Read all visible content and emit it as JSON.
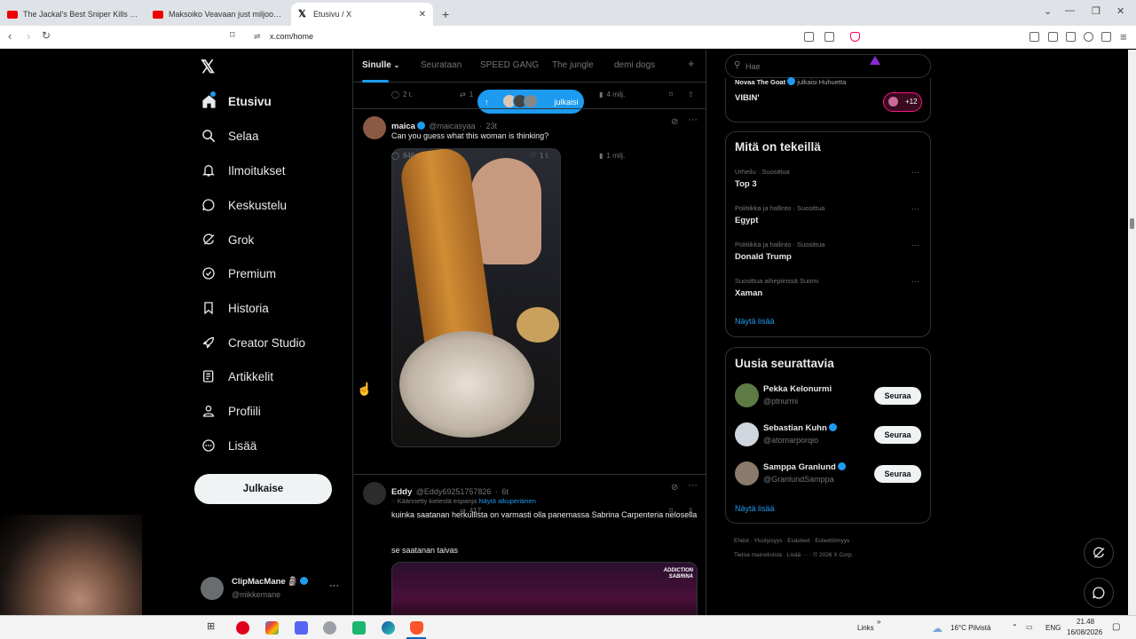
{
  "browser": {
    "tabs": [
      {
        "title": "The Jackal's Best Sniper Kills | The Da",
        "icon": "youtube-icon",
        "active": false
      },
      {
        "title": "Maksoiko Veavaan just miljoonan vil",
        "icon": "youtube-icon",
        "active": false
      },
      {
        "title": "Etusivu / X",
        "icon": "x-icon",
        "active": true
      }
    ],
    "new_tab": "+",
    "url": "x.com/home"
  },
  "sidebar": {
    "logo": "𝕏",
    "items": [
      {
        "label": "Etusivu",
        "icon": "home-icon",
        "active": true
      },
      {
        "label": "Selaa",
        "icon": "search-icon"
      },
      {
        "label": "Ilmoitukset",
        "icon": "bell-icon"
      },
      {
        "label": "Keskustelu",
        "icon": "chat-bubble-icon"
      },
      {
        "label": "Grok",
        "icon": "grok-icon"
      },
      {
        "label": "Premium",
        "icon": "verified-badge-icon"
      },
      {
        "label": "Historia",
        "icon": "bookmark-icon"
      },
      {
        "label": "Creator Studio",
        "icon": "rocket-icon"
      },
      {
        "label": "Artikkelit",
        "icon": "article-icon"
      },
      {
        "label": "Profiili",
        "icon": "person-icon"
      },
      {
        "label": "Lisää",
        "icon": "more-circle-icon"
      }
    ],
    "post_button": "Julkaise",
    "account": {
      "name": "ClipMacMane",
      "emoji": "🗿",
      "handle": "@mikkemane",
      "more": "···"
    }
  },
  "feed": {
    "tabs": [
      "Sinulle",
      "Seurataan",
      "SPEED GANG",
      "The jungle",
      "demi dogs"
    ],
    "active_tab": "Sinulle",
    "add_tab": "+",
    "new_posts_label": "julkaisi",
    "prev_post_stats": {
      "replies": "2 t.",
      "reposts": "1",
      "views": "4 milj."
    },
    "posts": [
      {
        "name": "maica",
        "handle": "@maicasyaa",
        "time": "23t",
        "text": "Can you guess what this woman is thinking?",
        "stats": {
          "replies": "646",
          "reposts": "417",
          "likes": "1 t.",
          "views": "1 milj."
        }
      },
      {
        "name": "Eddy",
        "handle": "@Eddy69251757826",
        "time": "6t",
        "translation_note": "Käännetty kielestä espanja",
        "translation_link": "Näytä alkuperäinen",
        "text": "kuinka saatanan herkullista on varmasti olla panemassa Sabrina Carpenteria nelosella",
        "text2": "se saatanan taivas",
        "media_label": "ADDICTION SABRINA"
      }
    ]
  },
  "right": {
    "search_placeholder": "Hae",
    "top_snippet": {
      "name": "Novaa The Goat",
      "action": "julkaisi Huhuetta",
      "title": "VIBIN'",
      "count": "+12"
    },
    "trends": {
      "title": "Mitä on tekeillä",
      "items": [
        {
          "meta": "Urheilu · Suosittua",
          "name": "Top 3"
        },
        {
          "meta": "Politiikka ja hallinto · Suosittua",
          "name": "Egypt"
        },
        {
          "meta": "Politiikka ja hallinto · Suosittua",
          "name": "Donald Trump"
        },
        {
          "meta": "Suosittua aihepiirissä Suomi",
          "name": "Xaman"
        }
      ],
      "show_more": "Näytä lisää"
    },
    "follow": {
      "title": "Uusia seurattavia",
      "items": [
        {
          "name": "Pekka Kelonurmi",
          "handle": "@ptnurmi",
          "verified": false,
          "button": "Seuraa"
        },
        {
          "name": "Sebastian Kuhn",
          "handle": "@atomarporqio",
          "verified": true,
          "button": "Seuraa"
        },
        {
          "name": "Samppa Granlund",
          "handle": "@GranlundSamppa",
          "verified": true,
          "button": "Seuraa"
        }
      ],
      "show_more": "Näytä lisää"
    },
    "footer": {
      "line1": [
        "Ehdot",
        "Yksityisyys",
        "Evästeet",
        "Esteettömyys"
      ],
      "line2": [
        "Tietoa mainoksista",
        "Lisää ···",
        "© 2026 X Corp."
      ]
    }
  },
  "taskbar": {
    "links": "Links",
    "weather": "16°C Pilvistä",
    "lang": "ENG",
    "time": "21.48",
    "date": "16/08/2026"
  }
}
